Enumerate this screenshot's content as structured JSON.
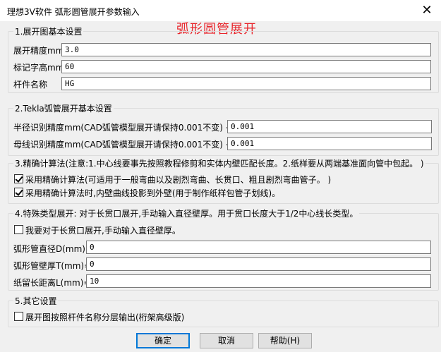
{
  "window": {
    "title": "理想3V软件 弧形圆管展开参数输入",
    "close_glyph": "✕"
  },
  "banner": "弧形圆管展开",
  "section1": {
    "legend": "1.展开图基本设置",
    "precision_label": "展开精度mm",
    "precision_value": "3.0",
    "text_height_label": "标记字高mm",
    "text_height_value": "60",
    "member_name_label": "杆件名称",
    "member_name_value": "HG"
  },
  "section2": {
    "legend": "2.Tekla弧管展开基本设置",
    "radius_label": "半径识别精度mm(CAD弧管模型展开请保持0.001不变) <",
    "radius_value": "0.001",
    "bus_label": "母线识别精度mm(CAD弧管模型展开请保持0.001不变) <",
    "bus_value": "0.001"
  },
  "section3": {
    "legend": "3.精确计算法(注意:1.中心线要事先按照教程修剪和实体内壁匹配长度。2.纸样要从两端基准面向管中包起。 )",
    "opt1_label": "采用精确计算法(可适用于一般弯曲以及剧烈弯曲、长贯口、粗且剧烈弯曲管子。 )",
    "opt1_checked": true,
    "opt2_label": "采用精确计算法时,内壁曲线投影到外壁(用于制作纸样包管子划线)。",
    "opt2_checked": true
  },
  "section4": {
    "legend": "4.特殊类型展开: 对于长贯口展开,手动输入直径壁厚。用于贯口长度大于1/2中心线长类型。",
    "opt_label": "我要对于长贯口展开,手动输入直径壁厚。",
    "opt_checked": false,
    "diameter_label": "弧形管直径D(mm)=",
    "diameter_value": "0",
    "thickness_label": "弧形管壁厚T(mm)=",
    "thickness_value": "0",
    "reserve_label": "纸留长距离L(mm)=",
    "reserve_value": "10"
  },
  "section5": {
    "legend": "5.其它设置",
    "opt_label": "展开图按照杆件名称分层输出(桁架高级版)",
    "opt_checked": false
  },
  "buttons": {
    "ok": "确定",
    "cancel": "取消",
    "help": "帮助(H)"
  }
}
